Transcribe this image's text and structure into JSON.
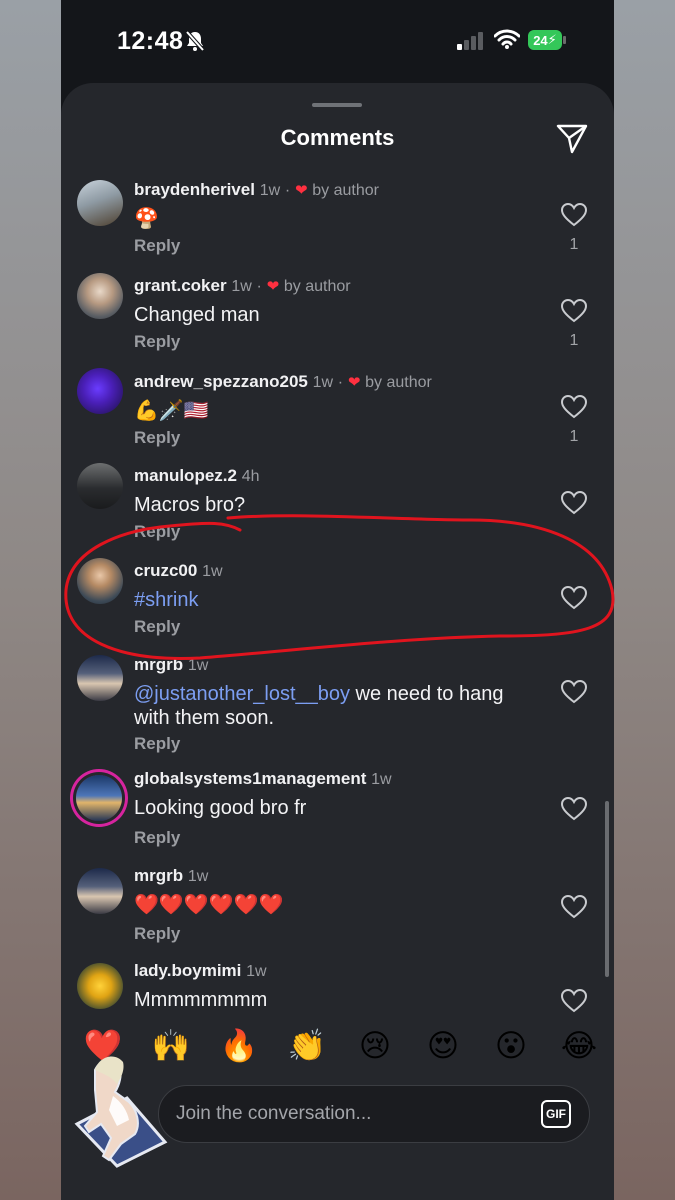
{
  "status": {
    "time": "12:48",
    "battery": "24"
  },
  "sheet": {
    "title": "Comments"
  },
  "comments": [
    {
      "user": "braydenherivel",
      "time": "1w",
      "by_author": "by author",
      "text": "🍄",
      "reply": "Reply",
      "likes": "1"
    },
    {
      "user": "grant.coker",
      "time": "1w",
      "by_author": "by author",
      "text": "Changed man",
      "reply": "Reply",
      "likes": "1"
    },
    {
      "user": "andrew_spezzano205",
      "time": "1w",
      "by_author": "by author",
      "text": "💪🗡️🇺🇸",
      "reply": "Reply",
      "likes": "1"
    },
    {
      "user": "manulopez.2",
      "time": "4h",
      "text": "Macros bro?",
      "reply": "Reply"
    },
    {
      "user": "cruzc00",
      "time": "1w",
      "hashtag": "#shrink",
      "reply": "Reply"
    },
    {
      "user": "mrgrb",
      "time": "1w",
      "mention": "@justanother_lost__boy",
      "text": " we need to hang with them soon.",
      "reply": "Reply"
    },
    {
      "user": "globalsystems1management",
      "time": "1w",
      "text": "Looking good bro fr",
      "reply": "Reply"
    },
    {
      "user": "mrgrb",
      "time": "1w",
      "text": "❤️❤️❤️❤️❤️❤️",
      "reply": "Reply"
    },
    {
      "user": "lady.boymimi",
      "time": "1w",
      "text": "Mmmmmmmm"
    }
  ],
  "emoji_bar": [
    "❤️",
    "🙌",
    "🔥",
    "👏",
    "😢",
    "😍",
    "😮",
    "😂"
  ],
  "composer": {
    "placeholder": "Join the conversation...",
    "gif_label": "GIF"
  },
  "colors": {
    "sheet_bg": "#25272c",
    "link_blue": "#7c9ef2",
    "like_red": "#ff3040",
    "annotation_red": "#e0141e"
  }
}
